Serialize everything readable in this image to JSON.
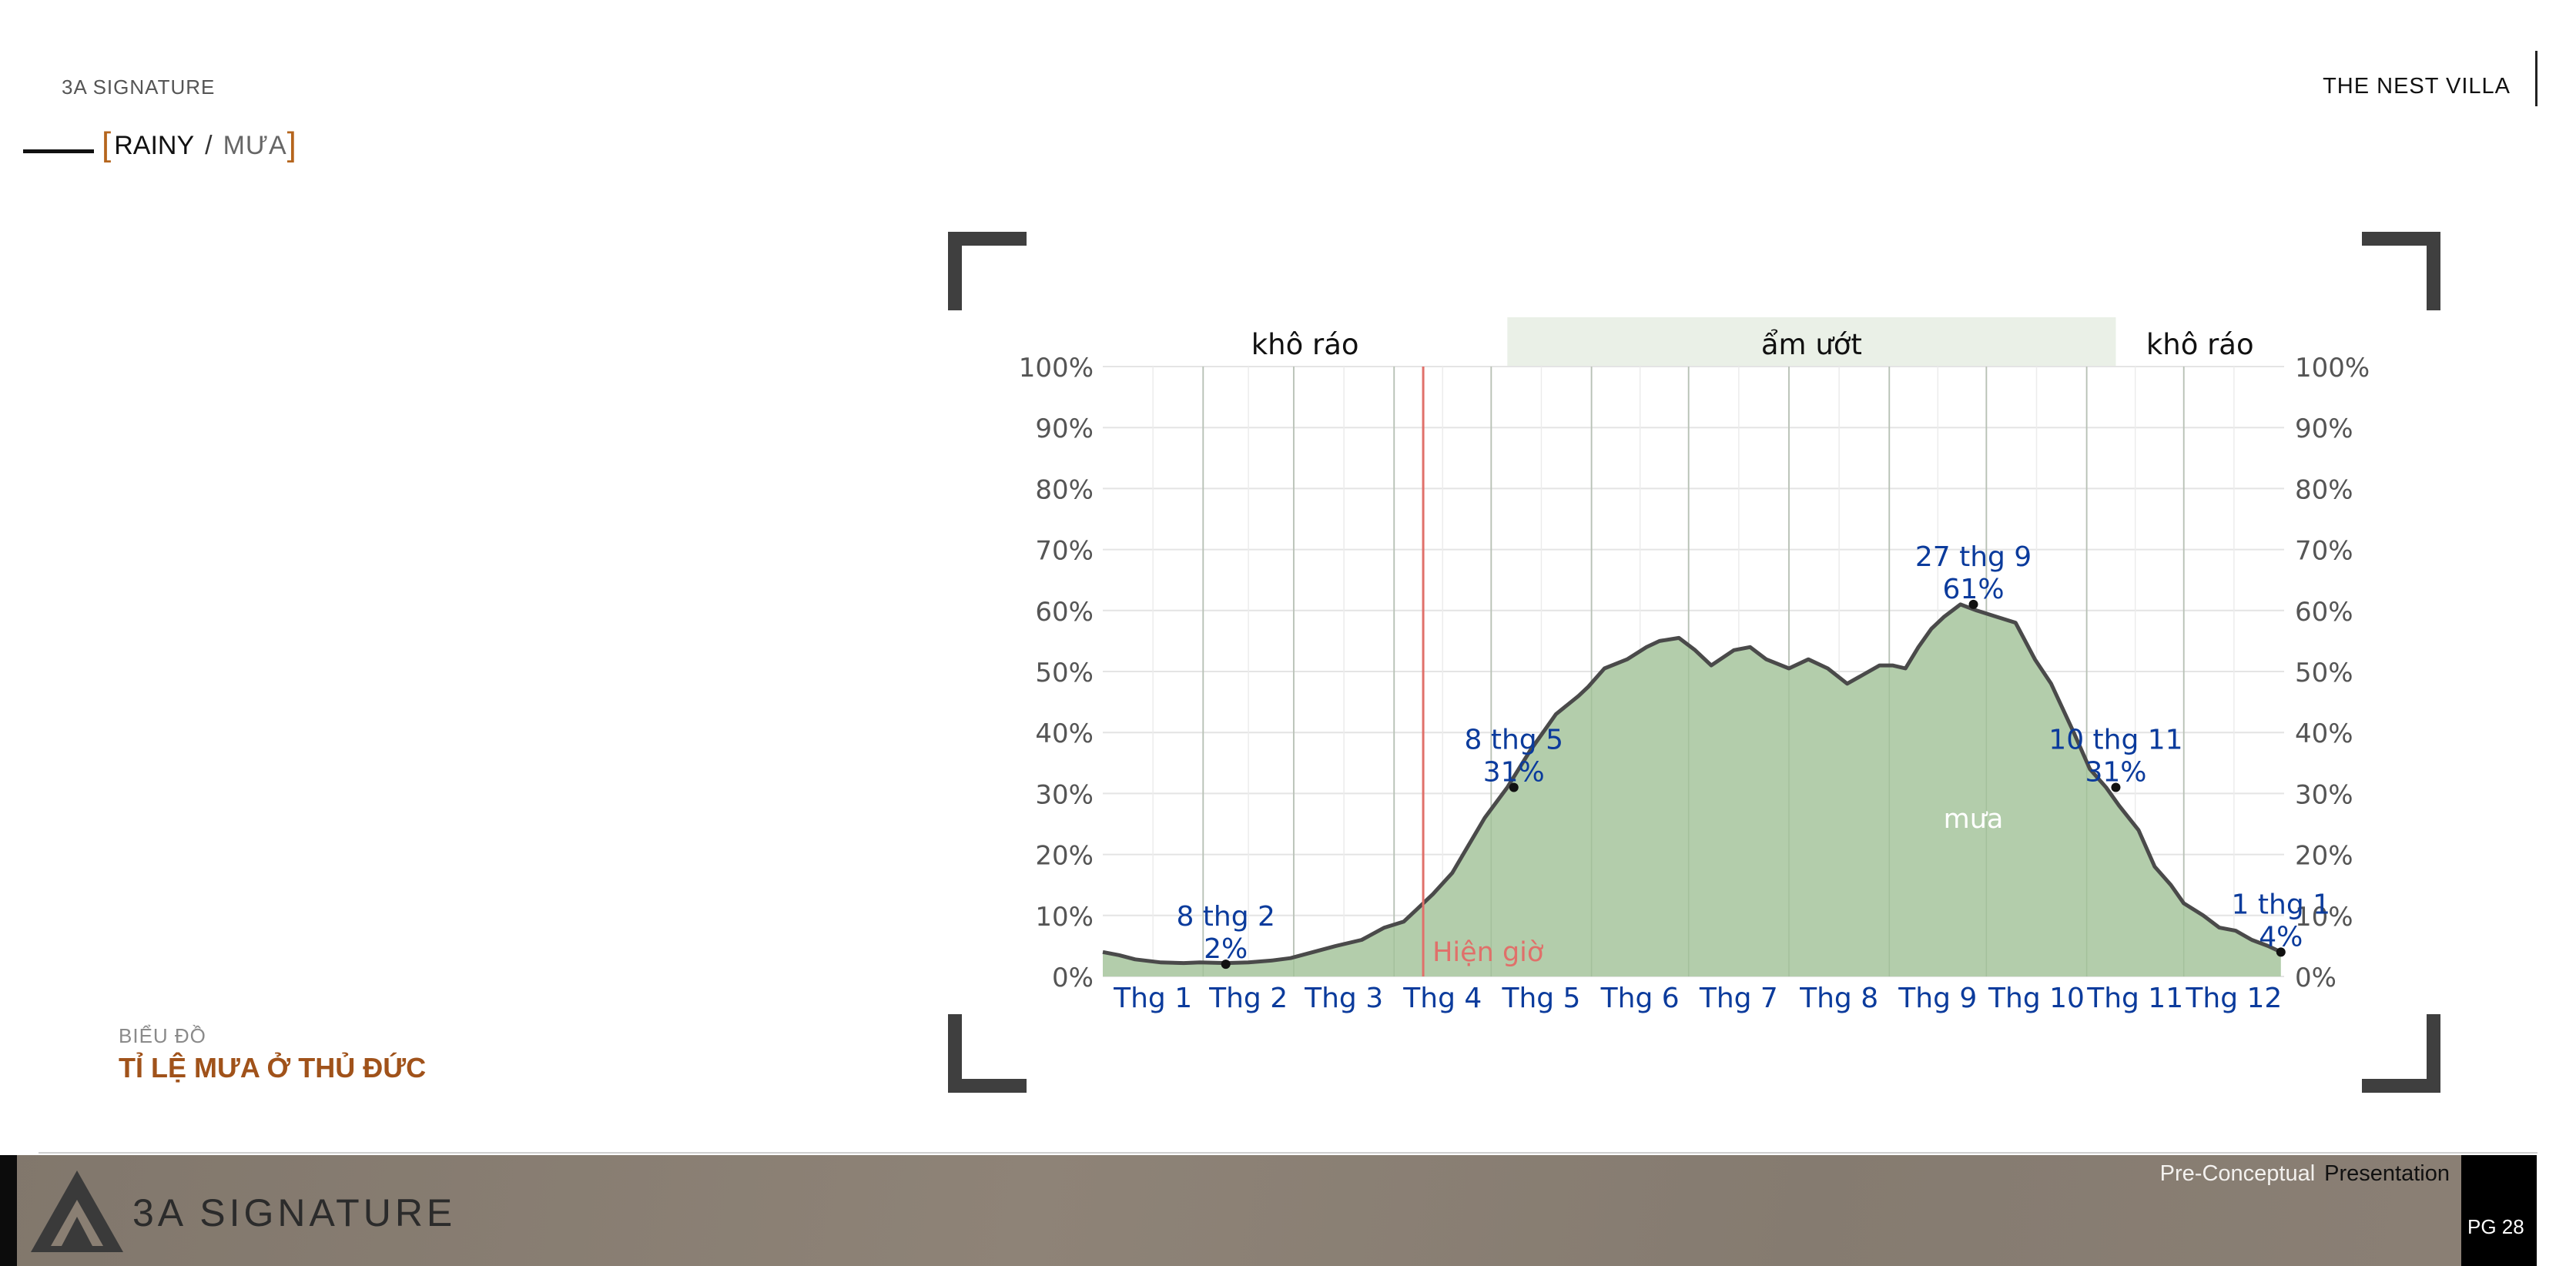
{
  "header": {
    "brand": "3A SIGNATURE",
    "project": "THE NEST VILLA"
  },
  "section": {
    "bracket_open": "[",
    "english": "RAINY",
    "slash": "/",
    "vietnamese": "MƯA",
    "bracket_close": "]"
  },
  "caption": {
    "label": "BIỂU ĐỒ",
    "title": "TỈ LỆ MƯA Ở THỦ ĐỨC"
  },
  "footer": {
    "logo_text": "3A SIGNATURE",
    "presentation_a": "Pre-Conceptual",
    "presentation_b": "Presentation",
    "page": "PG 28"
  },
  "colors": {
    "accent": "#a0521a",
    "bracket": "#b5651d",
    "area_fill": "#b3cdab",
    "line": "#4a4a4a",
    "label_blue": "#0b3b9c",
    "now_line": "#e0706a",
    "wet_band": "#eaf0e7"
  },
  "chart_data": {
    "type": "area",
    "title": "",
    "xlabel": "",
    "ylabel": "",
    "ylim": [
      0,
      100
    ],
    "y_unit": "%",
    "y_ticks": [
      "0%",
      "10%",
      "20%",
      "30%",
      "40%",
      "50%",
      "60%",
      "70%",
      "80%",
      "90%",
      "100%"
    ],
    "y_tick_values": [
      0,
      10,
      20,
      30,
      40,
      50,
      60,
      70,
      80,
      90,
      100
    ],
    "month_labels": [
      "Thg 1",
      "Thg 2",
      "Thg 3",
      "Thg 4",
      "Thg 5",
      "Thg 6",
      "Thg 7",
      "Thg 8",
      "Thg 9",
      "Thg 10",
      "Thg 11",
      "Thg 12"
    ],
    "month_starts": [
      0,
      31,
      59,
      90,
      120,
      151,
      181,
      212,
      243,
      273,
      304,
      334
    ],
    "days_in_year": 365,
    "seasons": [
      {
        "label": "khô ráo",
        "start_day": 0,
        "end_day": 125,
        "wet": false
      },
      {
        "label": "ẩm ướt",
        "start_day": 125,
        "end_day": 313,
        "wet": true
      },
      {
        "label": "khô ráo",
        "start_day": 313,
        "end_day": 365,
        "wet": false
      }
    ],
    "now_marker": {
      "label": "Hiện giờ",
      "day": 99
    },
    "series_label": "mưa",
    "series": [
      {
        "name": "mưa",
        "x": [
          0,
          5,
          10,
          18,
          25,
          30,
          38,
          45,
          52,
          58,
          65,
          72,
          80,
          87,
          93,
          97,
          102,
          108,
          113,
          118,
          125,
          132,
          140,
          147,
          150,
          155,
          162,
          168,
          172,
          178,
          183,
          188,
          195,
          200,
          205,
          212,
          218,
          224,
          230,
          235,
          240,
          244,
          248,
          252,
          256,
          260,
          265,
          270,
          276,
          282,
          288,
          293,
          300,
          305,
          310,
          314,
          320,
          325,
          330,
          334,
          340,
          345,
          350,
          355,
          360,
          364
        ],
        "values": [
          4,
          3.5,
          2.8,
          2.3,
          2.2,
          2.3,
          2.2,
          2.3,
          2.6,
          3,
          4,
          5,
          6,
          8,
          9,
          11,
          13.5,
          17,
          21.5,
          26,
          31,
          37,
          43,
          46,
          47.5,
          50.5,
          52,
          54,
          55,
          55.5,
          53.5,
          51,
          53.5,
          54,
          52,
          50.5,
          52,
          50.5,
          48,
          49.5,
          51,
          51,
          50.5,
          54,
          57,
          59,
          61,
          60,
          59,
          58,
          52,
          48,
          40,
          34,
          31,
          28,
          24,
          18,
          15,
          12,
          10,
          8,
          7.5,
          6,
          5,
          4
        ]
      }
    ],
    "annotations": [
      {
        "date": "8 thg 2",
        "value_label": "2%",
        "day": 38,
        "value": 2
      },
      {
        "date": "8 thg 5",
        "value_label": "31%",
        "day": 127,
        "value": 31
      },
      {
        "date": "27 thg 9",
        "value_label": "61%",
        "day": 269,
        "value": 61
      },
      {
        "date": "10 thg 11",
        "value_label": "31%",
        "day": 313,
        "value": 31
      },
      {
        "date": "1 thg 1",
        "value_label": "4%",
        "day": 364,
        "value": 4
      }
    ],
    "grid": true,
    "legend": "none"
  }
}
